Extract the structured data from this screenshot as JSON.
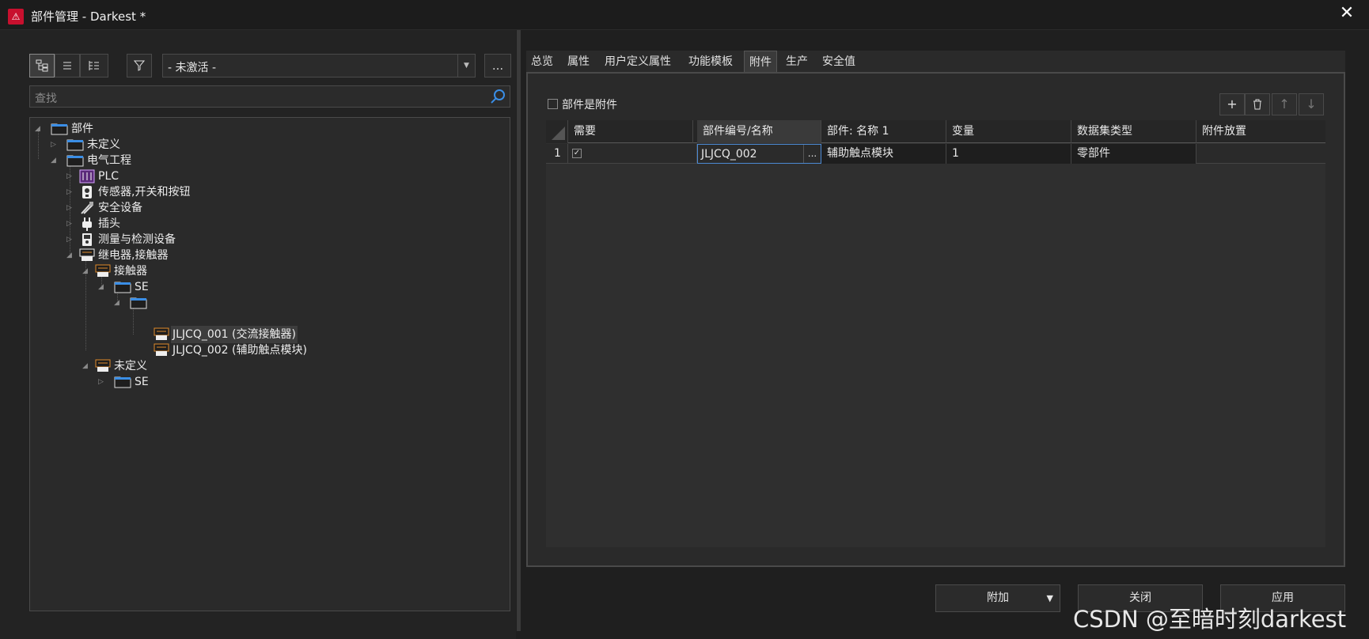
{
  "window": {
    "title": "部件管理 - Darkest *",
    "logo_icon": "eplan-logo-icon",
    "close_label": "✕"
  },
  "left": {
    "more_label": "...",
    "filter_value": "- 未激活 -",
    "search_placeholder": "查找",
    "tree": [
      {
        "label": "部件",
        "icon": "folder-icon",
        "expanded": true
      },
      {
        "label": "未定义",
        "icon": "folder-icon",
        "expanded": false
      },
      {
        "label": "电气工程",
        "icon": "folder-icon",
        "expanded": true
      },
      {
        "label": "PLC",
        "icon": "plc-icon",
        "expanded": false
      },
      {
        "label": "传感器,开关和按钮",
        "icon": "sensor-icon",
        "expanded": false
      },
      {
        "label": "安全设备",
        "icon": "safety-icon",
        "expanded": false
      },
      {
        "label": "插头",
        "icon": "plug-icon",
        "expanded": false
      },
      {
        "label": "测量与检测设备",
        "icon": "meter-icon",
        "expanded": false
      },
      {
        "label": "继电器,接触器",
        "icon": "relay-icon",
        "expanded": true
      },
      {
        "label": "接触器",
        "icon": "relay-icon",
        "expanded": true
      },
      {
        "label": "SE",
        "icon": "folder-icon",
        "expanded": true
      },
      {
        "label": "",
        "icon": "folder-icon",
        "expanded": true
      },
      {
        "label": "JLJCQ_001 (交流接触器)",
        "icon": "relay-icon",
        "selected": true
      },
      {
        "label": "JLJCQ_002 (辅助触点模块)",
        "icon": "relay-icon"
      },
      {
        "label": "未定义",
        "icon": "relay-icon",
        "expanded": true
      },
      {
        "label": "SE",
        "icon": "folder-icon",
        "expanded": false
      }
    ]
  },
  "right": {
    "tabs": [
      "总览",
      "属性",
      "用户定义属性",
      "功能模板",
      "附件",
      "生产",
      "安全值"
    ],
    "active_tab": "附件",
    "is_accessory_label": "部件是附件",
    "toolbar_icons": [
      "add-icon",
      "delete-icon",
      "move-up-icon",
      "move-down-icon"
    ],
    "grid": {
      "columns": [
        "需要",
        "部件编号/名称",
        "部件: 名称 1",
        "变量",
        "数据集类型",
        "附件放置"
      ],
      "rows": [
        {
          "index": "1",
          "required": true,
          "part_number": "JLJCQ_002",
          "name1": "辅助触点模块",
          "variant": "1",
          "dataset_type": "零部件",
          "placement": ""
        }
      ],
      "ellipsis": "..."
    }
  },
  "buttons": {
    "attach": "附加",
    "close": "关闭",
    "apply": "应用"
  },
  "watermark": "CSDN @至暗时刻darkest"
}
